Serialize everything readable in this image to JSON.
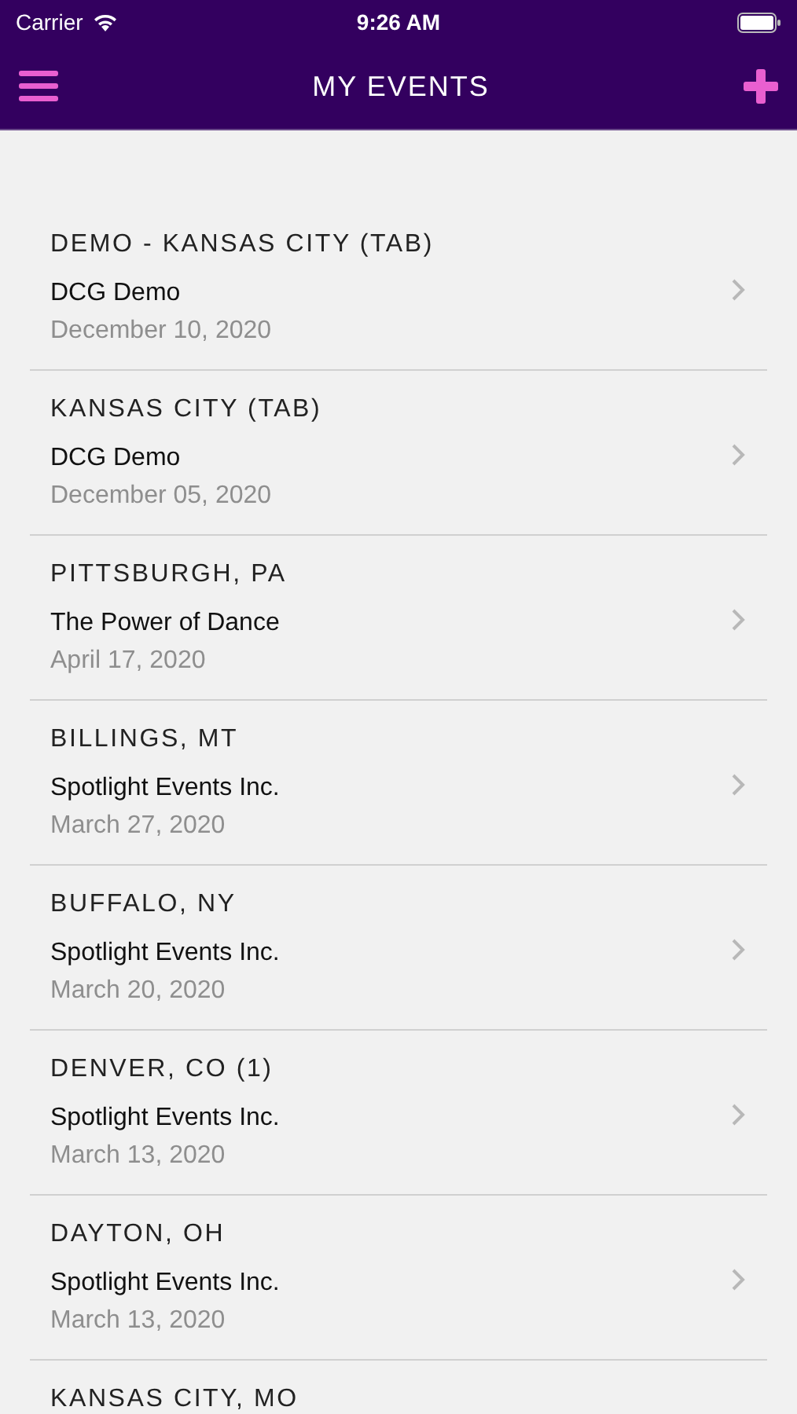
{
  "status_bar": {
    "carrier": "Carrier",
    "time": "9:26 AM"
  },
  "nav_bar": {
    "title": "MY EVENTS"
  },
  "events": [
    {
      "title": "DEMO - KANSAS CITY (TAB)",
      "organizer": "DCG Demo",
      "date": "December 10, 2020"
    },
    {
      "title": "KANSAS CITY (TAB)",
      "organizer": "DCG Demo",
      "date": "December 05, 2020"
    },
    {
      "title": "PITTSBURGH, PA",
      "organizer": "The Power of Dance",
      "date": "April 17, 2020"
    },
    {
      "title": "BILLINGS, MT",
      "organizer": "Spotlight Events Inc.",
      "date": "March 27, 2020"
    },
    {
      "title": "BUFFALO, NY",
      "organizer": "Spotlight Events Inc.",
      "date": "March 20, 2020"
    },
    {
      "title": "DENVER, CO (1)",
      "organizer": "Spotlight Events Inc.",
      "date": "March 13, 2020"
    },
    {
      "title": "DAYTON, OH",
      "organizer": "Spotlight Events Inc.",
      "date": "March 13, 2020"
    },
    {
      "title": "KANSAS CITY, MO"
    }
  ]
}
